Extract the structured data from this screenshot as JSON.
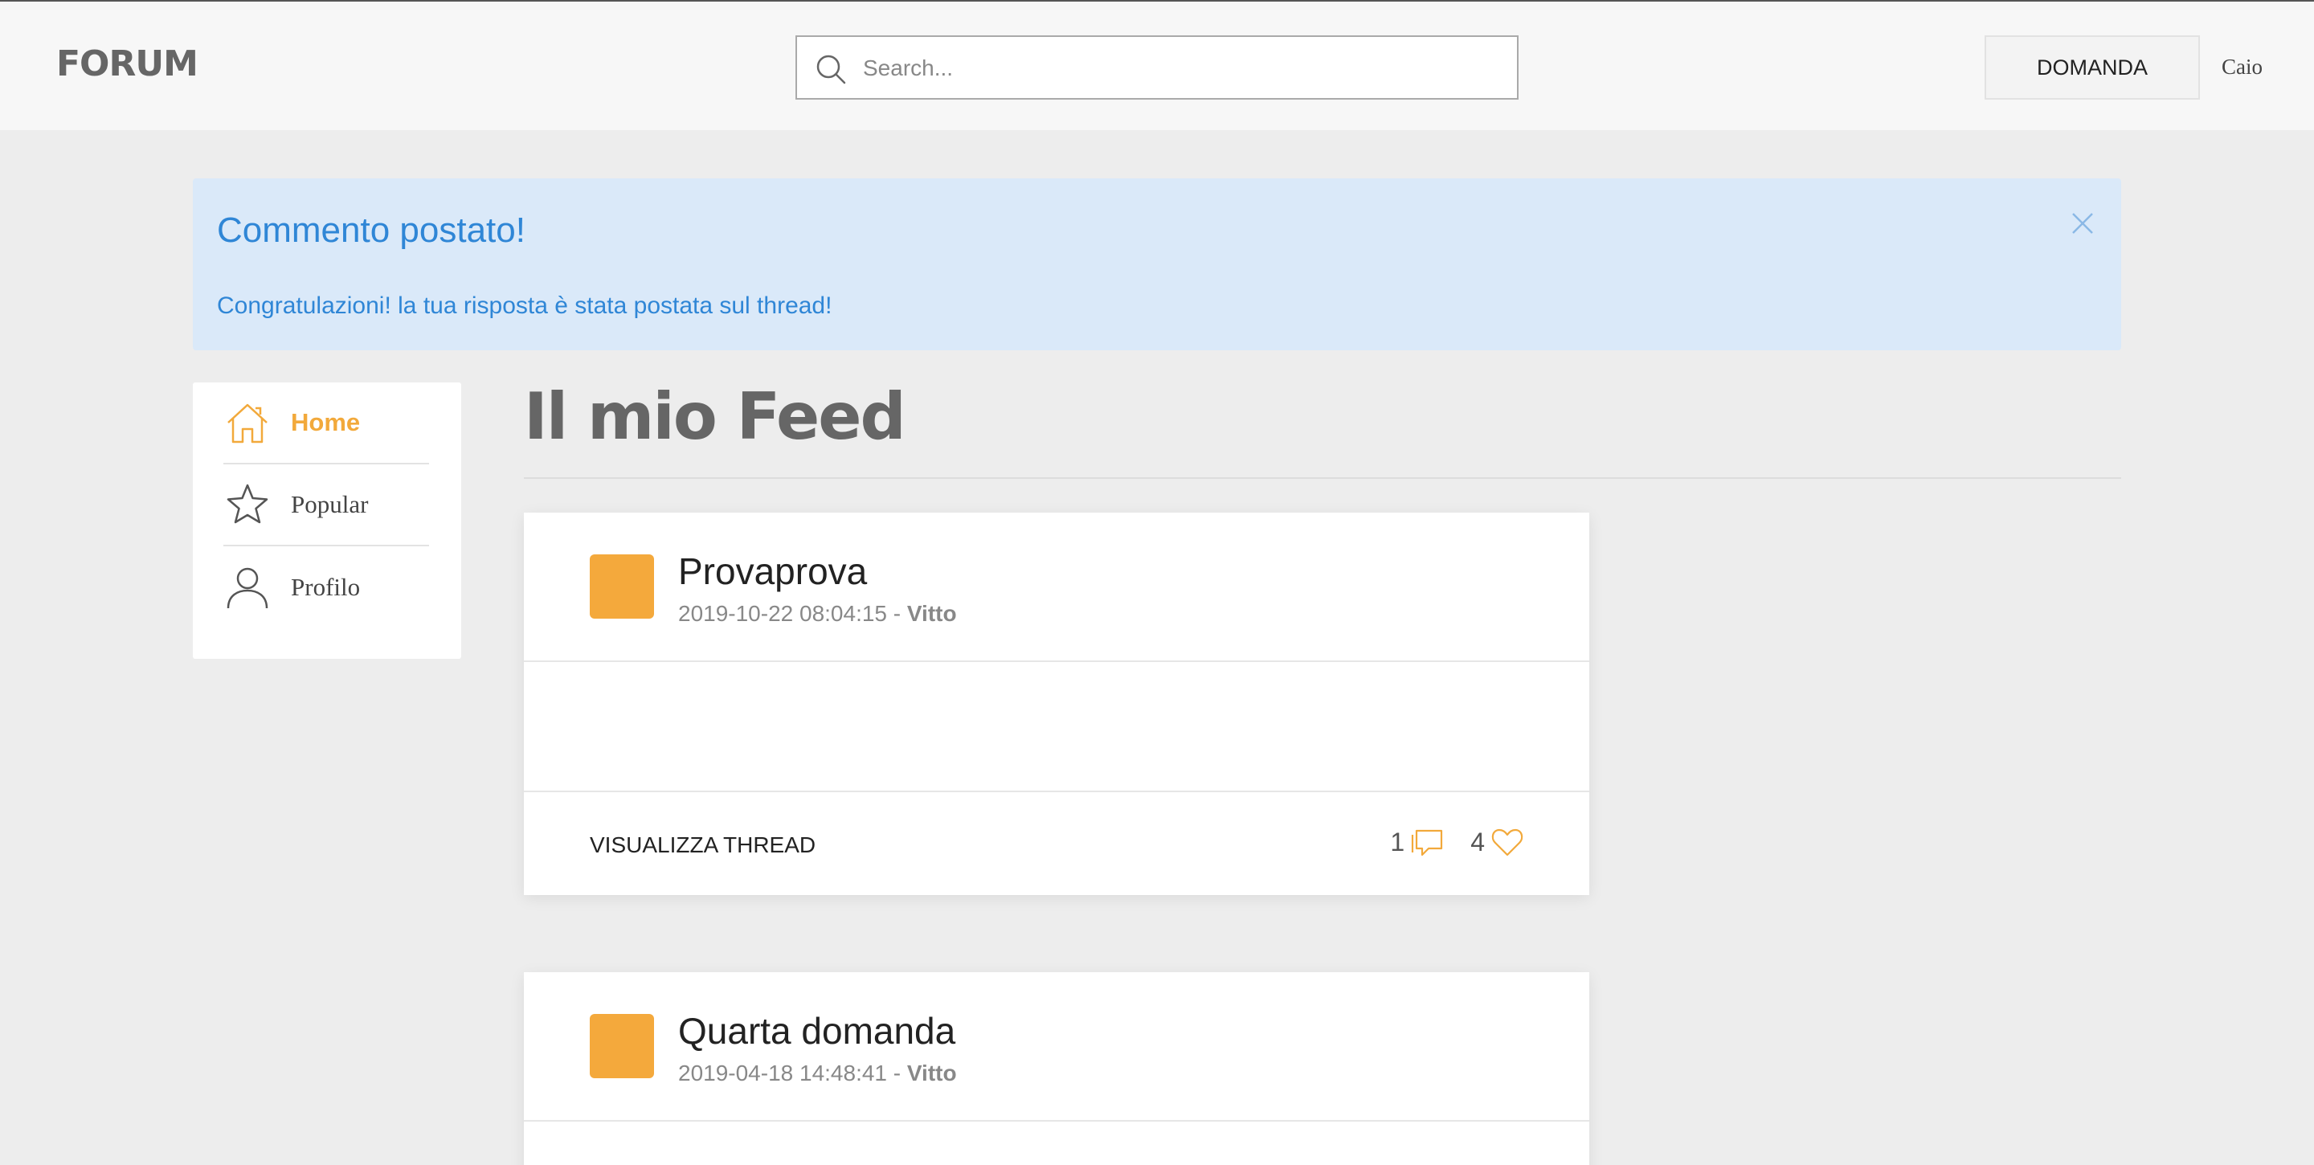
{
  "header": {
    "logo": "FORUM",
    "search_placeholder": "Search...",
    "ask_button": "DOMANDA",
    "username": "Caio"
  },
  "alert": {
    "title": "Commento postato!",
    "message": "Congratulazioni! la tua risposta è stata postata sul thread!",
    "color": "#2f86d6",
    "background": "#dae9f9"
  },
  "sidebar": {
    "items": [
      {
        "label": "Home",
        "icon": "home-icon",
        "active": true
      },
      {
        "label": "Popular",
        "icon": "star-icon",
        "active": false
      },
      {
        "label": "Profilo",
        "icon": "user-icon",
        "active": false
      }
    ],
    "accent": "#f2a93b"
  },
  "feed": {
    "title": "Il mio Feed",
    "threads": [
      {
        "title": "Provaprova",
        "date": "2019-10-22 08:04:15",
        "separator": " - ",
        "author": "Vitto",
        "view_label": "VISUALIZZA THREAD",
        "comments": "1",
        "likes": "4"
      },
      {
        "title": "Quarta domanda",
        "date": "2019-04-18 14:48:41",
        "separator": " - ",
        "author": "Vitto"
      }
    ]
  }
}
